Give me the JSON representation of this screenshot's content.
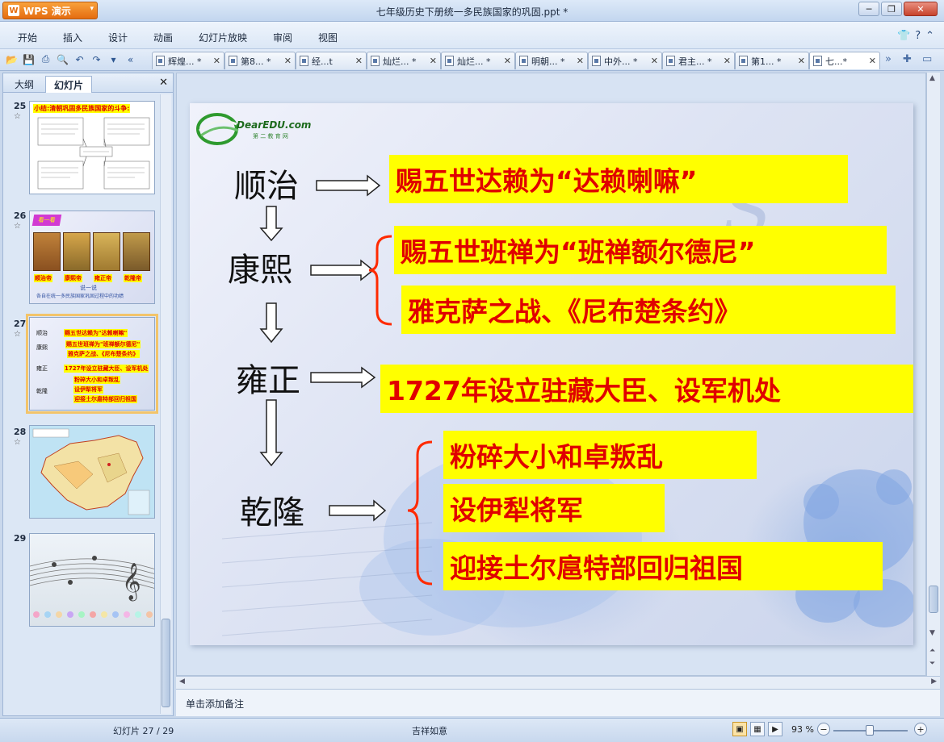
{
  "app": {
    "name": "WPS 演示",
    "title": "七年级历史下册统一多民族国家的巩固.ppt *"
  },
  "window_controls": {
    "minimize": "─",
    "restore": "❐",
    "close": "✕"
  },
  "menu": [
    "开始",
    "插入",
    "设计",
    "动画",
    "幻灯片放映",
    "审阅",
    "视图"
  ],
  "tabs": [
    {
      "label": "辉煌... *"
    },
    {
      "label": "第8... *"
    },
    {
      "label": "经...t"
    },
    {
      "label": "灿烂... *"
    },
    {
      "label": "灿烂... *"
    },
    {
      "label": "明朝... *"
    },
    {
      "label": "中外... *"
    },
    {
      "label": "君主... *"
    },
    {
      "label": "第1... *"
    },
    {
      "label": "七...*"
    }
  ],
  "left_panel": {
    "tabs": [
      "大纲",
      "幻灯片"
    ],
    "close": "✕"
  },
  "thumbnails": [
    {
      "num": "25",
      "star": "☆"
    },
    {
      "num": "26",
      "star": "☆"
    },
    {
      "num": "27",
      "star": "☆"
    },
    {
      "num": "28",
      "star": "☆"
    },
    {
      "num": "29",
      "star": ""
    }
  ],
  "thumb25": {
    "title": "小结:清朝巩固多民族国家的斗争:"
  },
  "thumb26": {
    "header": "看一看",
    "names": [
      "顺治帝",
      "康熙帝",
      "雍正帝",
      "乾隆帝"
    ],
    "caption1": "说一说",
    "caption2": "各自在统一多民族国家巩固过程中的功绩"
  },
  "thumb27": {
    "emperors": [
      "顺治",
      "康熙",
      "雍正",
      "乾隆"
    ],
    "items": [
      "赐五世达赖为\"达赖喇嘛\"",
      "赐五世班禅为\"班禅额尔德尼\"",
      "雅克萨之战、《尼布楚条约》",
      "1727年设立驻藏大臣、设军机处",
      "粉碎大小和卓叛乱",
      "设伊犁将军",
      "迎接土尔扈特部回归祖国"
    ]
  },
  "slide": {
    "logo": {
      "text": "DearEDU.com",
      "sub": "第 二 教 育 网"
    },
    "emperors": [
      "顺治",
      "康熙",
      "雍正",
      "乾隆"
    ],
    "boxes": {
      "shunzhi": "赐五世达赖为“达赖喇嘛”",
      "kangxi_1": "赐五世班禅为“班禅额尔德尼”",
      "kangxi_2": "雅克萨之战、《尼布楚条约》",
      "yongzheng": "1727年设立驻藏大臣、设军机处",
      "qianlong_1": "粉碎大小和卓叛乱",
      "qianlong_2": "设伊犁将军",
      "qianlong_3": "迎接土尔扈特部回归祖国"
    }
  },
  "notes": {
    "placeholder": "单击添加备注"
  },
  "status": {
    "slide": "幻灯片 27 / 29",
    "theme": "吉祥如意",
    "zoom": "93 %"
  },
  "colors": {
    "highlight": "#ffff00",
    "text_red": "#e00000",
    "bracket": "#ff2a00"
  }
}
